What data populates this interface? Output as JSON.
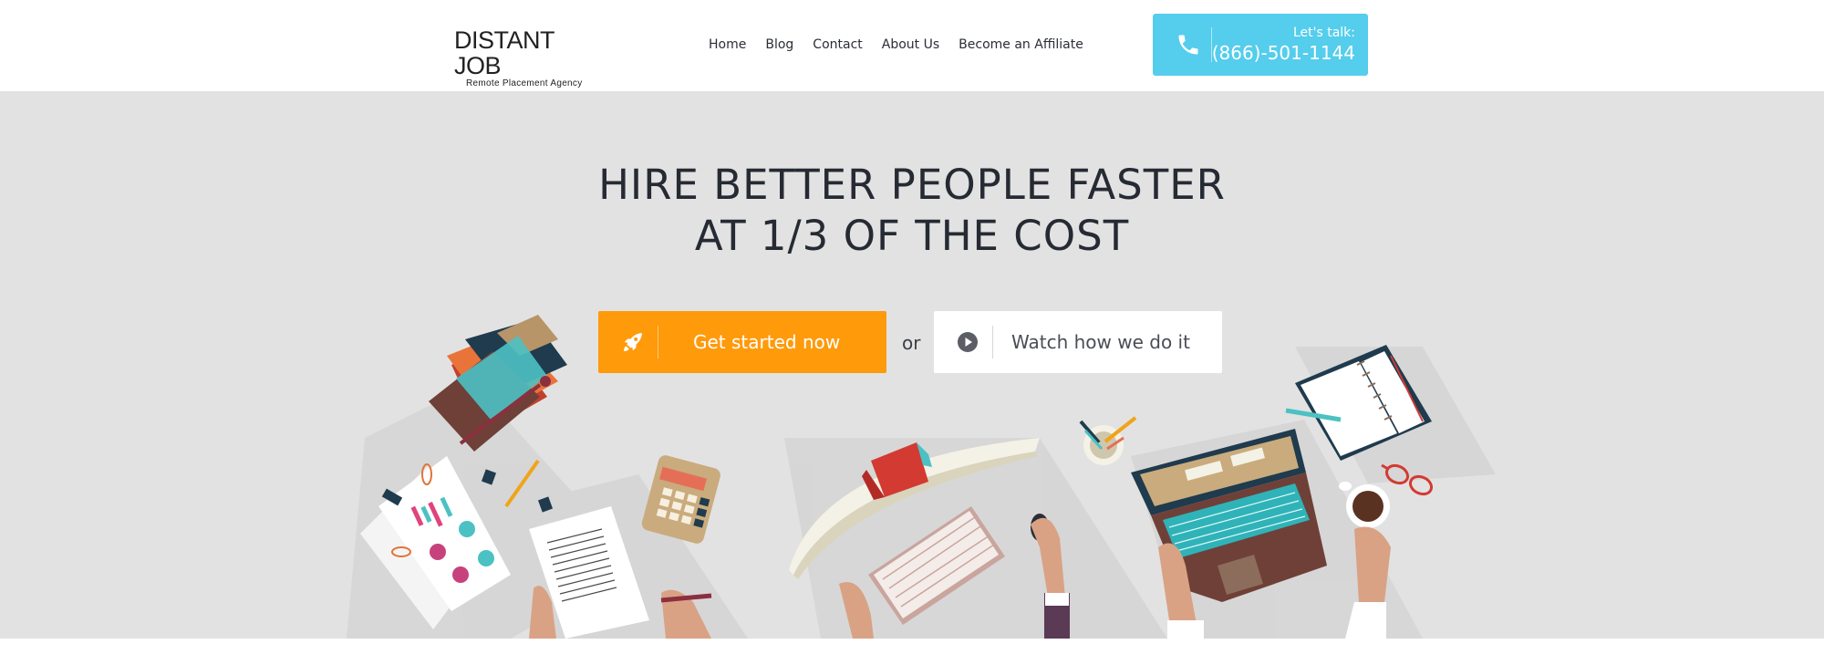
{
  "brand": {
    "name": "DISTANT JOB",
    "tagline": "Remote Placement Agency"
  },
  "nav": {
    "items": [
      {
        "label": "Home"
      },
      {
        "label": "Blog"
      },
      {
        "label": "Contact"
      },
      {
        "label": "About Us"
      },
      {
        "label": "Become an Affiliate"
      }
    ]
  },
  "call": {
    "prompt": "Let's talk:",
    "phone": "(866)-501-1144",
    "icon": "phone-icon"
  },
  "hero": {
    "headline_line1": "HIRE BETTER PEOPLE FASTER",
    "headline_line2": "AT 1/3 OF THE COST",
    "primary_cta": {
      "label": "Get started now",
      "icon": "rocket-icon"
    },
    "separator": "or",
    "secondary_cta": {
      "label": "Watch how we do it",
      "icon": "play-icon"
    }
  },
  "colors": {
    "accent_blue": "#55cdec",
    "accent_orange": "#ff9a0b",
    "hero_bg": "#e2e2e2",
    "text_dark": "#262a33"
  },
  "illustration": {
    "items": [
      "books-icon",
      "documents-icon",
      "calculator-icon",
      "monitor-icon",
      "keyboard-icon",
      "mouse-icon",
      "pencil-cup-icon",
      "laptop-icon",
      "notebook-icon",
      "coffee-cup-icon",
      "glasses-icon"
    ]
  }
}
